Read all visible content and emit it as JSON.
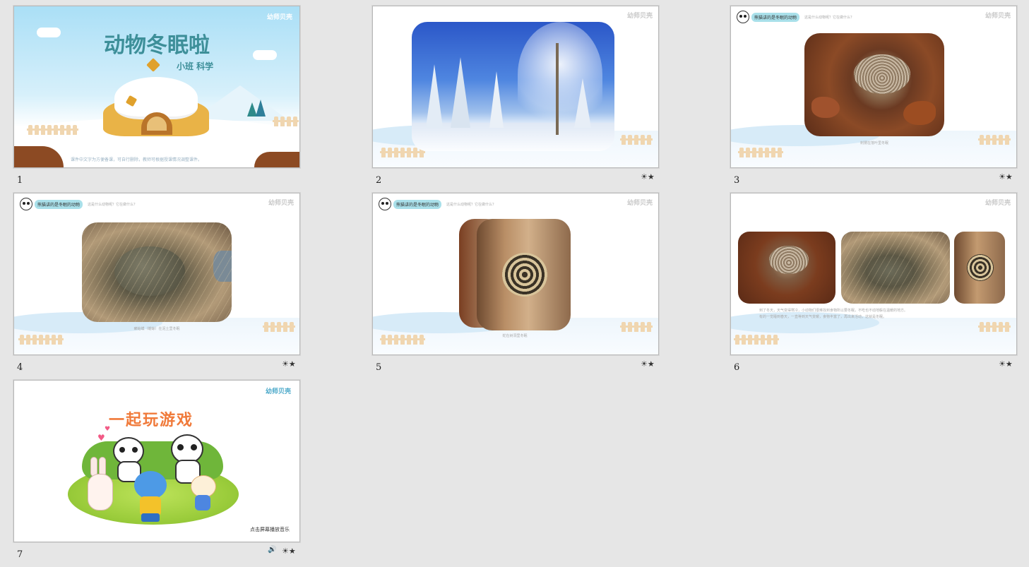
{
  "slides": [
    {
      "number": "1",
      "title": "动物冬眠啦",
      "subtitle": "小班 科学",
      "note": "课件中文字为方便备课，可自行删除，教师可根据授课情况调整课件。"
    },
    {
      "number": "2"
    },
    {
      "number": "3",
      "tag_label": "熊猫讲的是冬眠的动物",
      "question": "这是什么动物呢？它在做什么？",
      "caption": "刺猬在落叶里冬眠"
    },
    {
      "number": "4",
      "tag_label": "熊猫讲的是冬眠的动物",
      "question": "这是什么动物呢？它在做什么？",
      "caption": "癞蛤蟆（蟾蜍）在泥土里冬眠"
    },
    {
      "number": "5",
      "tag_label": "熊猫讲的是冬眠的动物",
      "question": "这是什么动物呢？它在做什么？",
      "caption": "蛇在树洞里冬眠"
    },
    {
      "number": "6",
      "caption_line1": "到了冬天，天气变得寒冷，小动物们很难找到食物所以要冬眠，不吃也不动地躲在温暖的地方。",
      "caption_line2": "有的一觉睡到春天，一直等到天气变暖，食物丰富了，再出来活动，这就是冬眠。"
    },
    {
      "number": "7",
      "title": "一起玩游戏",
      "footer": "点击屏幕播放音乐"
    }
  ],
  "badges": {
    "animation": "☀★",
    "audio": "🔊"
  },
  "brand": "幼师贝壳",
  "colors": {
    "background": "#e6e6e6",
    "title_teal": "#3d8f99",
    "game_title": "#f07a3a",
    "tag_bg": "#a9e0ea"
  }
}
